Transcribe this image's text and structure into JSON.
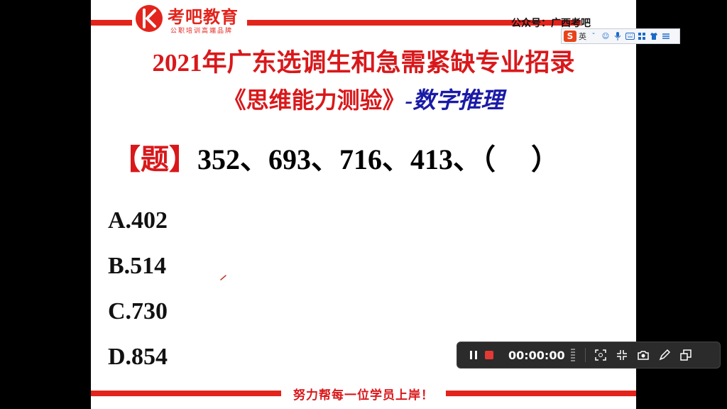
{
  "logo": {
    "name": "考吧教育",
    "tagline": "公职培训高端品牌"
  },
  "wechat": "公众号：广西考吧",
  "title": {
    "line1": "2021年广东选调生和急需紧缺专业招录",
    "line2_main": "《思维能力测验》",
    "line2_sub": "-数字推理"
  },
  "question": {
    "label": "【题】",
    "sequence": "352、693、716、413、（　 ）"
  },
  "options": [
    "A.402",
    "B.514",
    "C.730",
    "D.854"
  ],
  "slogan": "努力帮每一位学员上岸！",
  "ime": {
    "logo": "S",
    "lang": "英"
  },
  "recorder": {
    "time": "00:00:00"
  },
  "colors": {
    "brand_red": "#e3241c",
    "title_red": "#d9181b",
    "subtitle_blue": "#1a1aa8",
    "recorder_bg": "#2b2b2b",
    "record_red": "#e53935"
  }
}
